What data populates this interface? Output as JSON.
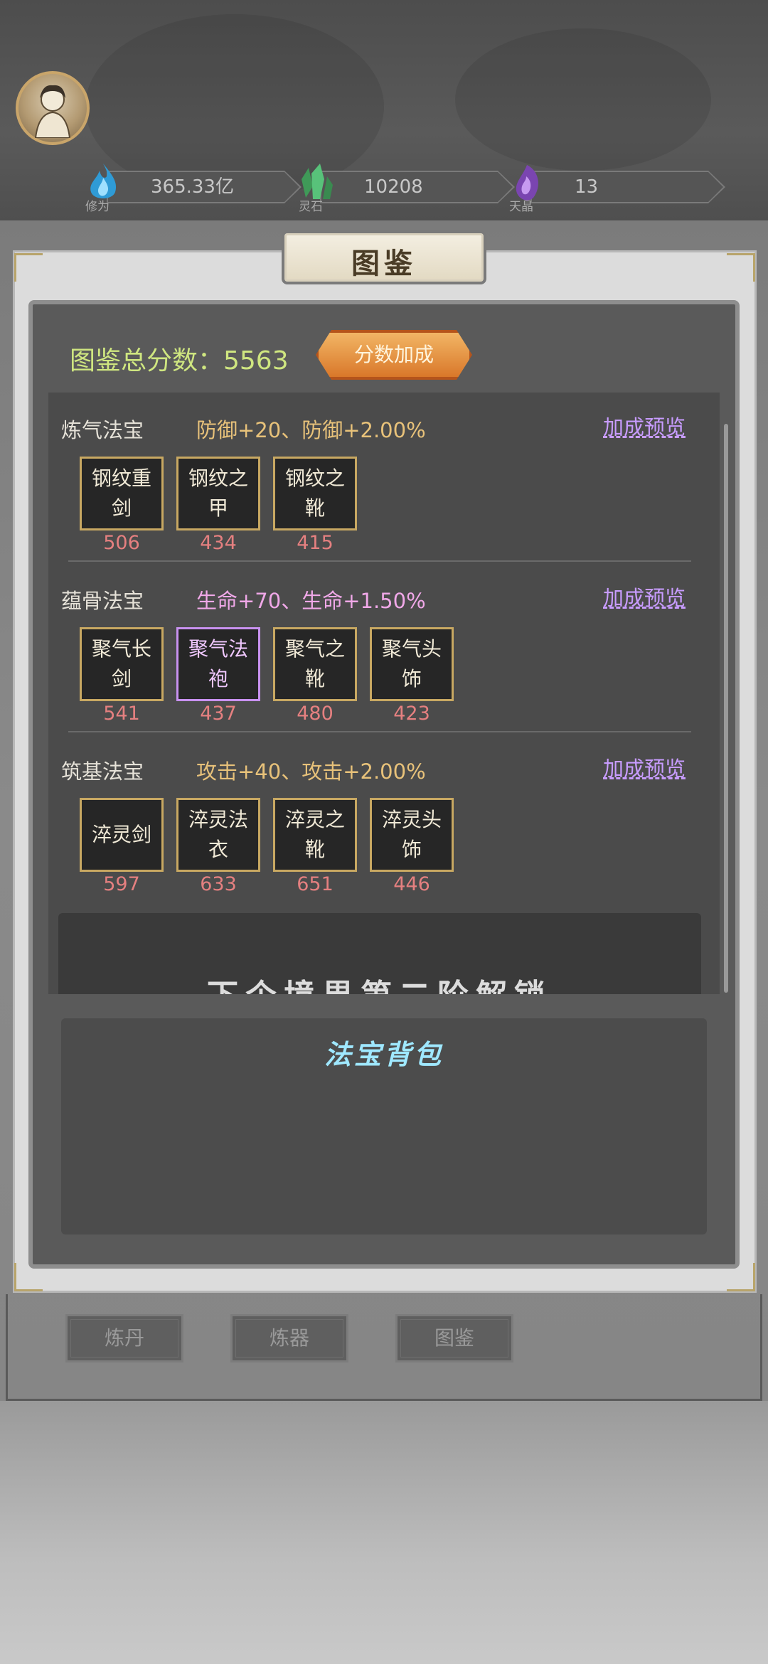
{
  "resources": [
    {
      "name": "修为",
      "value": "365.33亿",
      "color": "#3aa8d8"
    },
    {
      "name": "灵石",
      "value": "10208",
      "color": "#4caf6a"
    },
    {
      "name": "天晶",
      "value": "13",
      "color": "#8a4fc0"
    }
  ],
  "panel": {
    "title": "图鉴",
    "total_label": "图鉴总分数：5563",
    "bonus_button": "分数加成"
  },
  "sections": [
    {
      "name": "炼气法宝",
      "bonus": "防御+20、防御+2.00%",
      "bonus_color": "#e8c27a",
      "preview": "加成预览",
      "items": [
        {
          "label": "钢纹重剑",
          "score": "506",
          "rarity": "gold"
        },
        {
          "label": "钢纹之甲",
          "score": "434",
          "rarity": "gold"
        },
        {
          "label": "钢纹之靴",
          "score": "415",
          "rarity": "gold"
        }
      ]
    },
    {
      "name": "蕴骨法宝",
      "bonus": "生命+70、生命+1.50%",
      "bonus_color": "#f0a8e8",
      "preview": "加成预览",
      "items": [
        {
          "label": "聚气长剑",
          "score": "541",
          "rarity": "gold"
        },
        {
          "label": "聚气法袍",
          "score": "437",
          "rarity": "purple"
        },
        {
          "label": "聚气之靴",
          "score": "480",
          "rarity": "gold"
        },
        {
          "label": "聚气头饰",
          "score": "423",
          "rarity": "gold"
        }
      ]
    },
    {
      "name": "筑基法宝",
      "bonus": "攻击+40、攻击+2.00%",
      "bonus_color": "#e8c27a",
      "preview": "加成预览",
      "items": [
        {
          "label": "淬灵剑",
          "score": "597",
          "rarity": "gold"
        },
        {
          "label": "淬灵法衣",
          "score": "633",
          "rarity": "gold"
        },
        {
          "label": "淬灵之靴",
          "score": "651",
          "rarity": "gold"
        },
        {
          "label": "淬灵头饰",
          "score": "446",
          "rarity": "gold"
        }
      ]
    }
  ],
  "banner_text": "下个境界第二阶解锁",
  "bag": {
    "title": "法宝背包"
  },
  "tabs": [
    "炼丹",
    "炼器",
    "图鉴"
  ]
}
